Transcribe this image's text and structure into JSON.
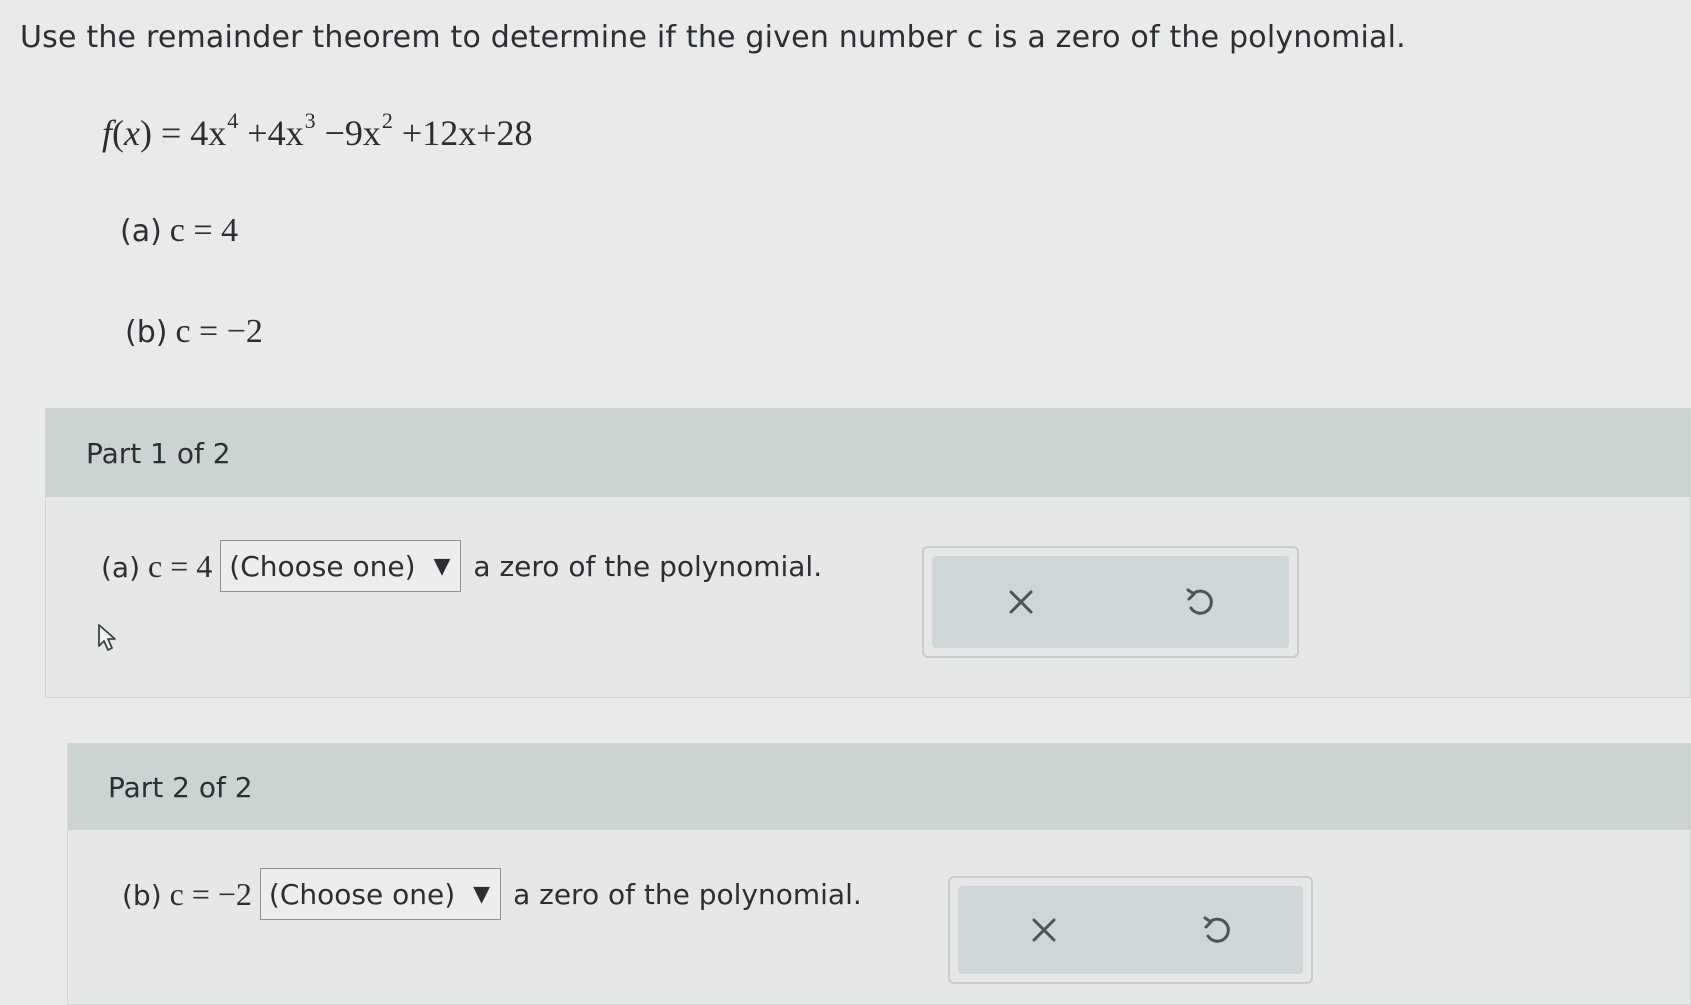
{
  "instructions": "Use the remainder theorem to determine if the given number c is a zero of the polynomial.",
  "polynomial": {
    "f": "f",
    "x": "x",
    "t1": "4x",
    "e1": "4",
    "t2": "+4x",
    "e2": "3",
    "t3": "−9x",
    "e3": "2",
    "t4": "+12x+28"
  },
  "given": {
    "a_label": "(a)",
    "a_value": "c = 4",
    "b_label": "(b)",
    "b_value": "c = −2"
  },
  "parts": [
    {
      "header": "Part 1 of 2",
      "label": "(a)",
      "value": "c = 4",
      "select_value": "(Choose one)",
      "suffix": "a zero of the polynomial."
    },
    {
      "header": "Part 2 of 2",
      "label": "(b)",
      "value": "c = −2",
      "select_value": "(Choose one)",
      "suffix": "a zero of the polynomial."
    }
  ],
  "icons": {
    "clear": "close-icon",
    "undo": "undo-icon",
    "dropdown": "triangle-down-icon",
    "pointer": "mouse-pointer-icon"
  },
  "colors": {
    "background": "#e9ebea",
    "part_header": "#cbd3d3",
    "action_fill": "#cfd6d7",
    "text": "#2b2f33"
  }
}
